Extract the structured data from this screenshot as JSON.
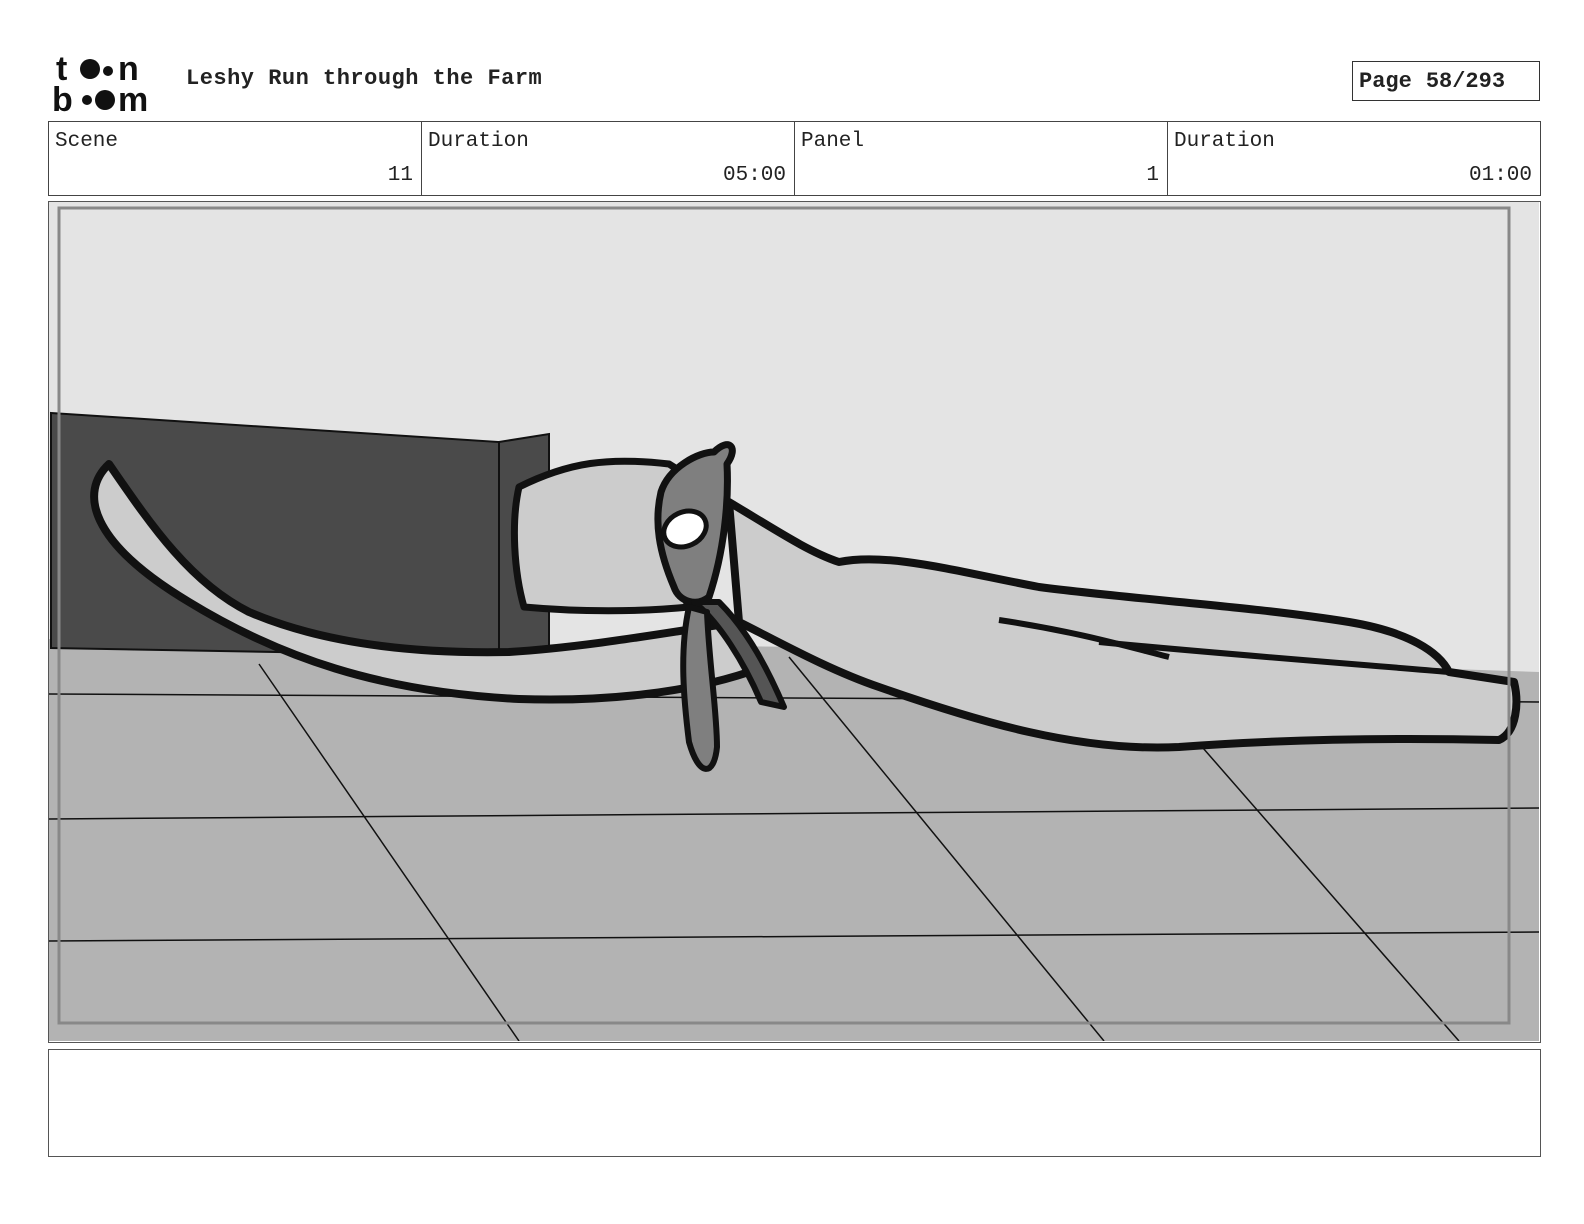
{
  "header": {
    "project_title": "Leshy Run through the Farm",
    "page_label": "Page",
    "page_value": "58/293"
  },
  "info": {
    "scene_label": "Scene",
    "scene_value": "11",
    "scene_duration_label": "Duration",
    "scene_duration_value": "05:00",
    "panel_label": "Panel",
    "panel_value": "1",
    "panel_duration_label": "Duration",
    "panel_duration_value": "01:00"
  },
  "notes": {
    "text": ""
  },
  "colors": {
    "sky": "#e4e4e4",
    "floor": "#b3b3b3",
    "wall": "#4a4a4a",
    "hose": "#cccccc",
    "figure": "#7f7f7f"
  },
  "icons": {
    "logo": "toon-boom-logo"
  }
}
